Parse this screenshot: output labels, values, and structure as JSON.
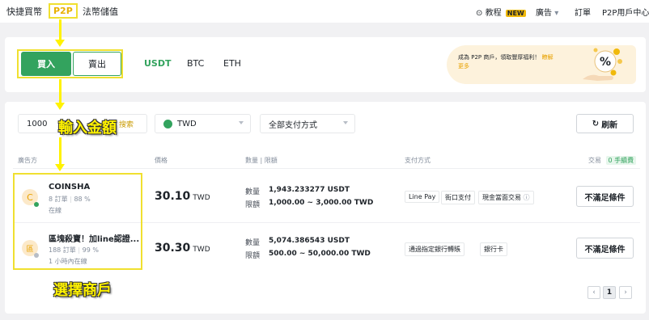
{
  "nav": {
    "quick_buy": "快捷買幣",
    "p2p": "P2P",
    "fiat_deposit": "法幣儲值",
    "tutorial": "教程",
    "new_badge": "NEW",
    "ads": "廣告",
    "orders": "訂單",
    "user_center": "P2P用戶中心"
  },
  "trade": {
    "buy_label": "買入",
    "sell_label": "賣出",
    "coins": [
      "USDT",
      "BTC",
      "ETH"
    ],
    "selected_coin": "USDT"
  },
  "promo": {
    "text": "成為 P2P 商戶，領取豐厚福利！",
    "link": "瞭解更多"
  },
  "filters": {
    "amount_value": "1000",
    "amount_search": "搜索",
    "currency": "TWD",
    "payment": "全部支付方式",
    "refresh_label": "刷新"
  },
  "table": {
    "headers": {
      "advertiser": "廣告方",
      "price": "價格",
      "limit": "數量 | 限額",
      "payment": "支付方式",
      "trade": "交易",
      "fee_badge": "0 手續費"
    },
    "rows": [
      {
        "name": "COINSHA",
        "avatar_letter": "C",
        "orders": "8 訂單",
        "completion": "88 %",
        "status": "在線",
        "price": "30.10",
        "currency": "TWD",
        "qty_label": "數量",
        "qty": "1,943.233277 USDT",
        "limit_label": "限額",
        "limit": "1,000.00 ~ 3,000.00 TWD",
        "payments": [
          "Line Pay",
          "街口支付",
          "現金當面交易"
        ],
        "action": "不滿足條件",
        "online_color": "#33a35e"
      },
      {
        "name": "區塊殺寶！加line認證...",
        "avatar_letter": "區",
        "orders": "188 訂單",
        "completion": "99 %",
        "status": "1 小時內在線",
        "price": "30.30",
        "currency": "TWD",
        "qty_label": "數量",
        "qty": "5,074.386543 USDT",
        "limit_label": "限額",
        "limit": "500.00 ~ 50,000.00 TWD",
        "payments": [
          "通過指定銀行轉賬",
          "銀行卡"
        ],
        "action": "不滿足條件",
        "online_color": "#b7bdc6"
      }
    ]
  },
  "pagination": {
    "current": "1"
  },
  "annotations": {
    "enter_amount": "輸入金額",
    "select_merchant": "選擇商戶"
  },
  "colors": {
    "accent": "#33a35e",
    "highlight": "#f0e030",
    "brand_yellow": "#f0b90b"
  }
}
